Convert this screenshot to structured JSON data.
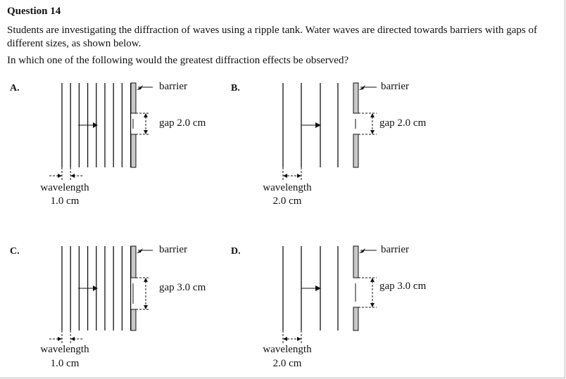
{
  "question": {
    "title": "Question 14",
    "stem_line1": "Students are investigating the diffraction of waves using a ripple tank. Water waves are directed towards barriers with gaps of different sizes, as shown below.",
    "stem_line2": "In which one of the following would the greatest diffraction effects be observed?"
  },
  "options": [
    {
      "letter": "A.",
      "barrier_label": "barrier",
      "gap_label": "gap 2.0 cm",
      "wavelength_label": "wavelength",
      "wavelength_value": "1.0 cm"
    },
    {
      "letter": "B.",
      "barrier_label": "barrier",
      "gap_label": "gap 2.0 cm",
      "wavelength_label": "wavelength",
      "wavelength_value": "2.0 cm"
    },
    {
      "letter": "C.",
      "barrier_label": "barrier",
      "gap_label": "gap 3.0 cm",
      "wavelength_label": "wavelength",
      "wavelength_value": "1.0 cm"
    },
    {
      "letter": "D.",
      "barrier_label": "barrier",
      "gap_label": "gap 3.0 cm",
      "wavelength_label": "wavelength",
      "wavelength_value": "2.0 cm"
    }
  ]
}
